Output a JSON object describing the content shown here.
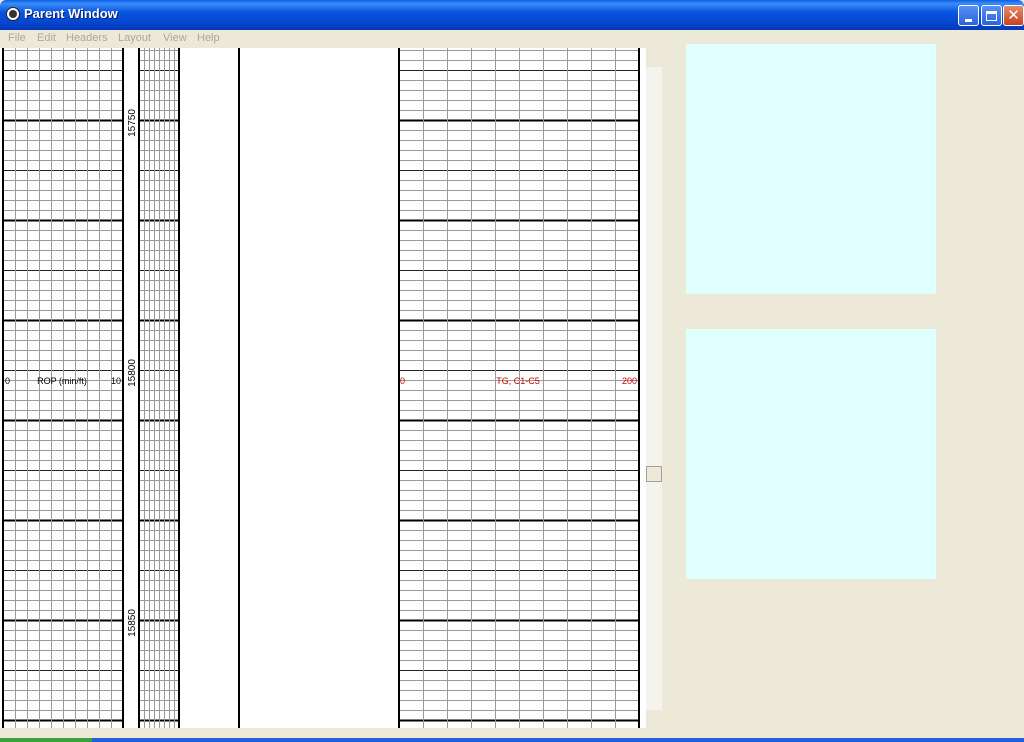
{
  "window": {
    "title": "Parent Window"
  },
  "menu": {
    "items": [
      "File",
      "Edit",
      "Headers",
      "Layout",
      "View",
      "Help"
    ]
  },
  "log": {
    "depth_labels": [
      "15750",
      "15800",
      "15850"
    ],
    "tracks": [
      {
        "name": "ROP (min/ft)",
        "min": "0",
        "max": "10",
        "color": "#000000"
      },
      {
        "name": "TG, C1-C5",
        "min": "0",
        "max": "200",
        "color": "#cc0000"
      }
    ]
  },
  "colors": {
    "panel": "#e0ffff",
    "title_bar": "#0a55e0",
    "curve_header": "#cc0000",
    "window_bg": "#ece9d8"
  }
}
